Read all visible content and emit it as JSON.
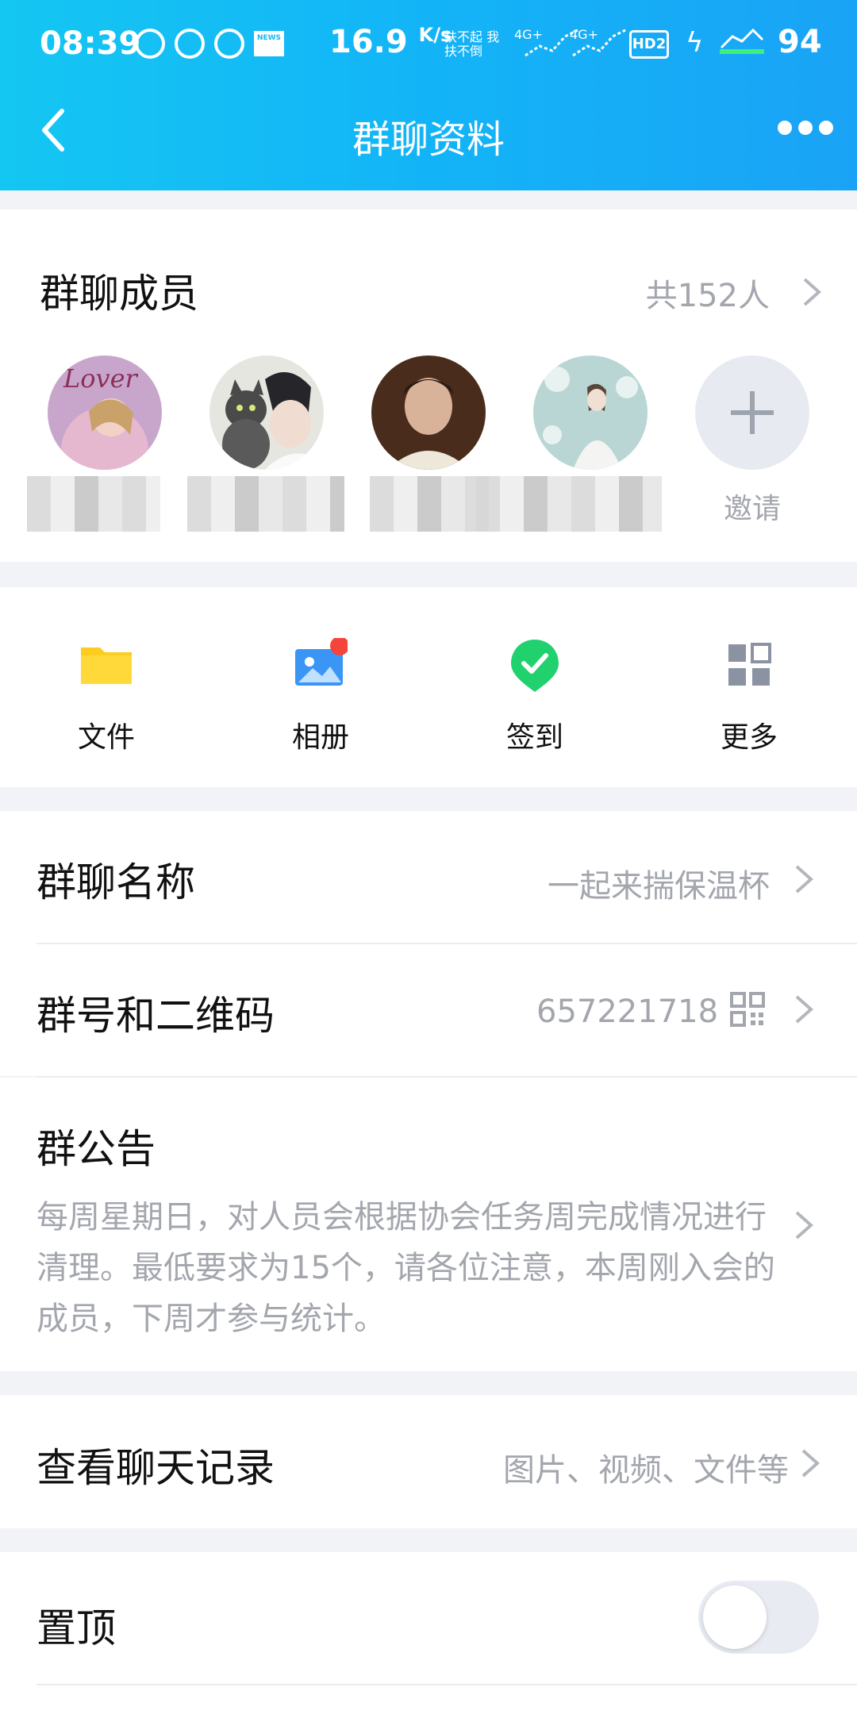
{
  "status_bar": {
    "time": "08:39",
    "speed": "16.9",
    "speed_unit": "K/s",
    "tiny_text": "扶不起 我扶不倒",
    "sig1_label": "4G+",
    "sig2_label": "4G+",
    "hd_label": "HD2",
    "battery": "94",
    "news_label": "NEWS"
  },
  "nav": {
    "title": "群聊资料"
  },
  "members": {
    "title": "群聊成员",
    "count": "共152人",
    "invite_label": "邀请",
    "avatars": [
      "lover-cover",
      "cat-boy",
      "young-man",
      "anime-girl"
    ]
  },
  "tools": [
    {
      "label": "文件",
      "icon": "folder-icon"
    },
    {
      "label": "相册",
      "icon": "photo-album-icon"
    },
    {
      "label": "签到",
      "icon": "checkin-icon"
    },
    {
      "label": "更多",
      "icon": "grid-icon"
    }
  ],
  "info": {
    "name_label": "群聊名称",
    "name_value": "一起来揣保温杯",
    "id_label": "群号和二维码",
    "id_value": "657221718",
    "notice_label": "群公告",
    "notice_text": "每周星期日，对人员会根据协会任务周完成情况进行清理。最低要求为15个，请各位注意，本周刚入会的成员，下周才参与统计。"
  },
  "history": {
    "label": "查看聊天记录",
    "value": "图片、视频、文件等"
  },
  "pin": {
    "label": "置顶",
    "enabled": false
  },
  "colors": {
    "header_start": "#14c6f2",
    "header_end": "#1aa3f6",
    "folder": "#fccd1e",
    "album": "#3b95f5",
    "checkin": "#21d16e",
    "badge": "#f5453b",
    "grid": "#8b93a3"
  }
}
